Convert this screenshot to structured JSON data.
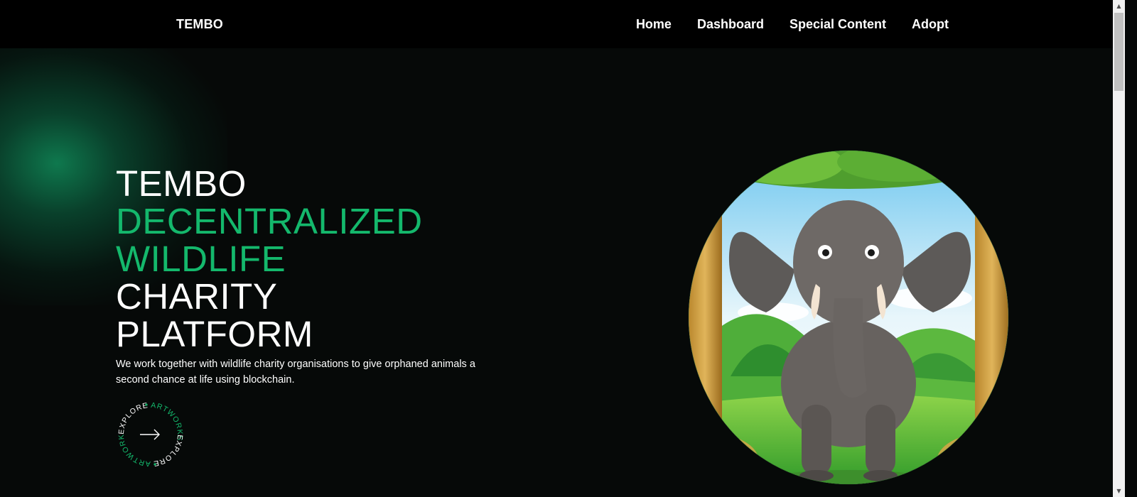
{
  "navbar": {
    "brand": "TEMBO",
    "links": [
      "Home",
      "Dashboard",
      "Special Content",
      "Adopt"
    ]
  },
  "hero": {
    "lines": [
      {
        "text": "TEMBO",
        "accent": false
      },
      {
        "text": "DECENTRALIZED",
        "accent": true
      },
      {
        "text": "WILDLIFE",
        "accent": true
      },
      {
        "text": "CHARITY",
        "accent": false
      },
      {
        "text": "PLATFORM",
        "accent": false
      }
    ],
    "description": "We work together with wildlife charity organisations to give orphaned animals a second chance at life using blockchain.",
    "explore_badge": {
      "word1": "EXPLORE",
      "word2": "ARTWORKS"
    }
  },
  "colors": {
    "accent": "#14b86c",
    "background": "#060908",
    "navbar": "#000000"
  },
  "icons": {
    "explore_arrow": "arrow-right-icon",
    "hero_image": "elephant-illustration"
  }
}
